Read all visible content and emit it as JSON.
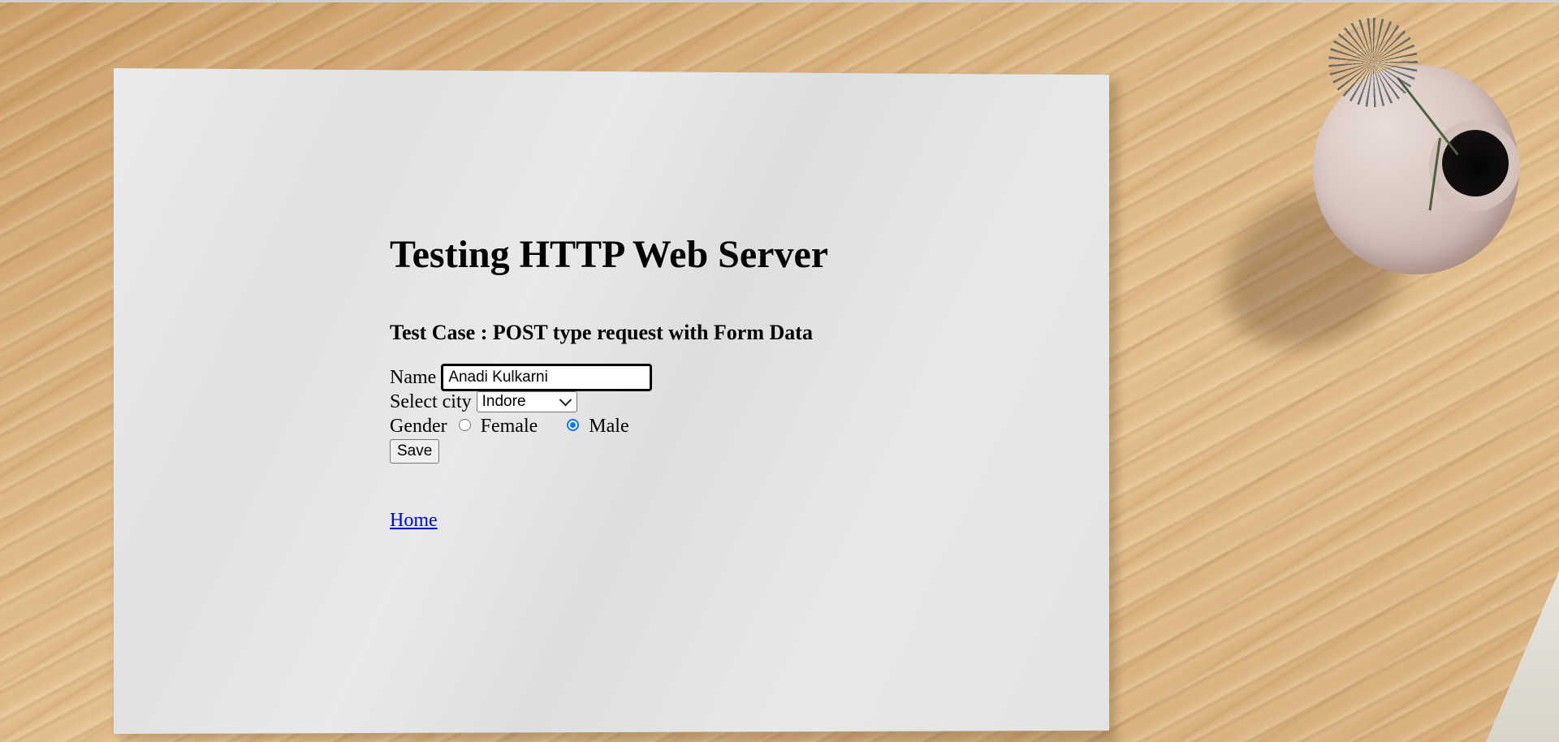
{
  "page": {
    "heading": "Testing HTTP Web Server",
    "subheading": "Test Case : POST type request with Form Data"
  },
  "form": {
    "name_label": "Name",
    "name_value": "Anadi Kulkarni",
    "city_label": "Select city",
    "city_selected": "Indore",
    "gender_label": "Gender",
    "gender_options": [
      "Female",
      "Male"
    ],
    "gender_selected": "Male",
    "save_label": "Save"
  },
  "links": {
    "home": "Home"
  },
  "colors": {
    "link": "#0000ee",
    "radio_accent": "#0075ff"
  }
}
